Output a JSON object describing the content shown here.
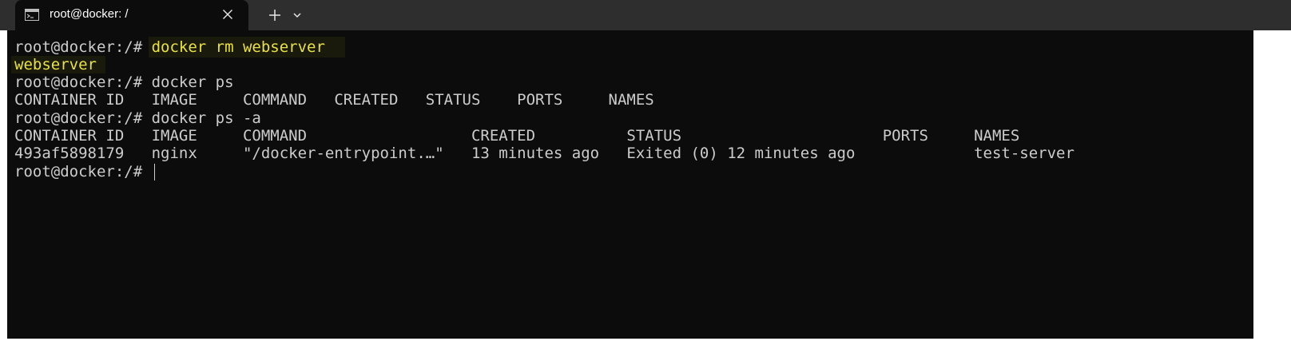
{
  "tab": {
    "title": "root@docker: /",
    "icon": "terminal-icon",
    "close_icon": "close-icon",
    "new_tab_icon": "plus-icon",
    "dropdown_icon": "chevron-down-icon"
  },
  "terminal": {
    "prompt": "root@docker:/# ",
    "lines": [
      {
        "prompt": "root@docker:/# ",
        "text": "docker rm webserver"
      },
      {
        "text": "webserver"
      },
      {
        "prompt": "root@docker:/# ",
        "text": "docker ps"
      },
      {
        "text": "CONTAINER ID   IMAGE     COMMAND   CREATED   STATUS    PORTS     NAMES"
      },
      {
        "prompt": "root@docker:/# ",
        "text": "docker ps -a"
      },
      {
        "text": "CONTAINER ID   IMAGE     COMMAND                  CREATED          STATUS                      PORTS     NAMES"
      },
      {
        "text": "493af5898179   nginx     \"/docker-entrypoint.…\"   13 minutes ago   Exited (0) 12 minutes ago             test-server"
      },
      {
        "prompt": "root@docker:/# ",
        "text": ""
      }
    ]
  },
  "colors": {
    "background": "#0c0c0c",
    "text": "#cccccc",
    "highlight_text": "#e8e04a",
    "scroll_mark": "#f2d21a",
    "tabbar": "#2e2e2e"
  }
}
